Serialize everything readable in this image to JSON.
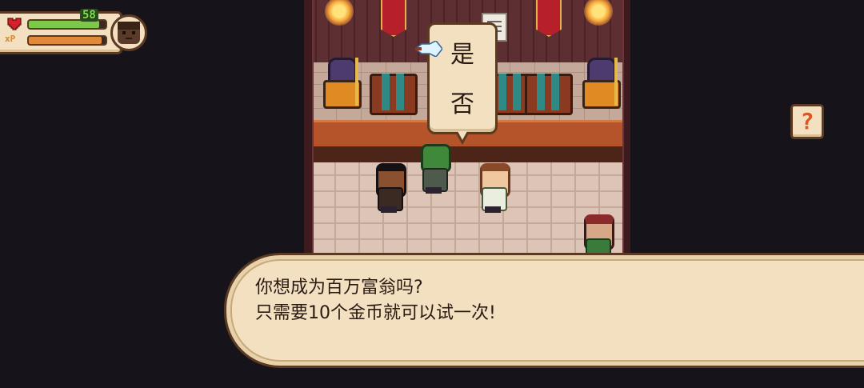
{
  "hud": {
    "hp_value": "58",
    "hp_fraction": 0.92,
    "xp_label": "xP",
    "xp_fraction": 0.95,
    "hp_color": "#7bc84a",
    "xp_color": "#e0893a"
  },
  "choice": {
    "options": [
      "是",
      "否"
    ],
    "selected_index": 0
  },
  "help": {
    "label": "?"
  },
  "dialog": {
    "line1": "你想成为百万富翁吗?",
    "line2": "只需要10个金币就可以试一次!"
  }
}
